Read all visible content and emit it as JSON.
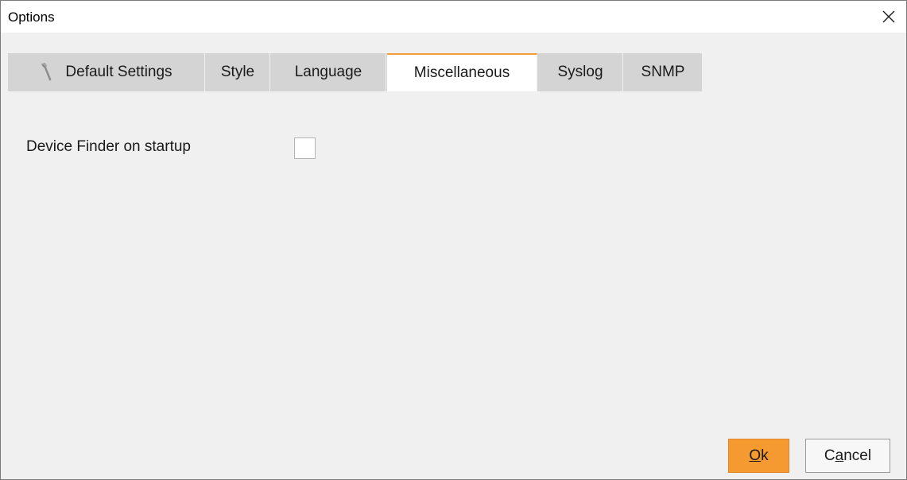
{
  "window": {
    "title": "Options",
    "close_icon": "close-icon"
  },
  "tabs": [
    {
      "label": "Default Settings",
      "icon": "wrench-icon",
      "active": false
    },
    {
      "label": "Style",
      "active": false
    },
    {
      "label": "Language",
      "active": false
    },
    {
      "label": "Miscellaneous",
      "active": true
    },
    {
      "label": "Syslog",
      "active": false
    },
    {
      "label": "SNMP",
      "active": false
    }
  ],
  "miscellaneous": {
    "device_finder_label": "Device Finder on startup",
    "device_finder_checked": false
  },
  "buttons": {
    "ok": {
      "mnemonic": "O",
      "rest": "k"
    },
    "cancel": {
      "pre": "C",
      "mnemonic": "a",
      "rest": "ncel"
    }
  },
  "colors": {
    "accent": "#f49a30",
    "active_tab_border": "#f39c3b",
    "tab_inactive": "#d4d4d4",
    "panel_bg": "#f0f0f0"
  }
}
